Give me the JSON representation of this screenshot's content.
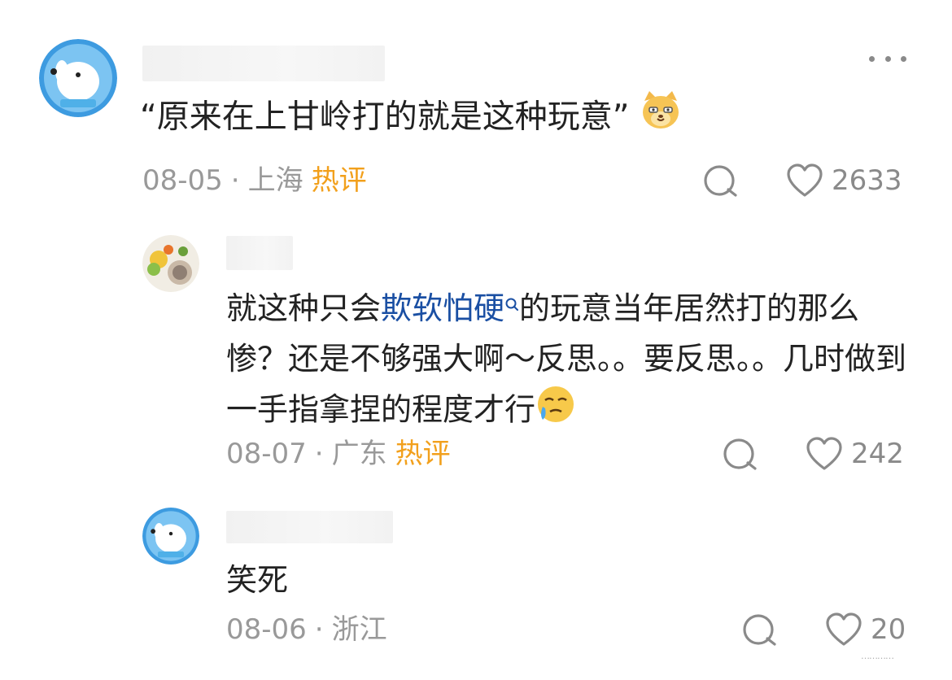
{
  "comment": {
    "text_before": "“原来在上甘岭打的就是这种玩意”",
    "emoji_icon": "cat-face-emoji-icon",
    "date": "08-05",
    "location": "上海",
    "hot_label": "热评",
    "like_count": "2633",
    "more_icon": "more-dots-icon",
    "reply_icon": "comment-bubble-icon",
    "like_icon": "heart-outline-icon"
  },
  "replies": [
    {
      "text_before": "就这种只会",
      "link_text": "欺软怕硬",
      "link_icon": "search-icon",
      "text_after": "的玩意当年居然打的那么惨？还是不够强大啊～反思。。要反思。。几时做到一手指拿捏的程度才行",
      "emoji_icon": "crying-face-emoji-icon",
      "date": "08-07",
      "location": "广东",
      "hot_label": "热评",
      "like_count": "242"
    },
    {
      "text": "笑死",
      "date": "08-06",
      "location": "浙江",
      "hot_label": "",
      "like_count": "20"
    }
  ],
  "watermark": "…………",
  "colors": {
    "text": "#222222",
    "meta": "#999999",
    "hot": "#f2a01c",
    "link": "#1a4fa3",
    "avatar_bg": "#3d9be0"
  }
}
